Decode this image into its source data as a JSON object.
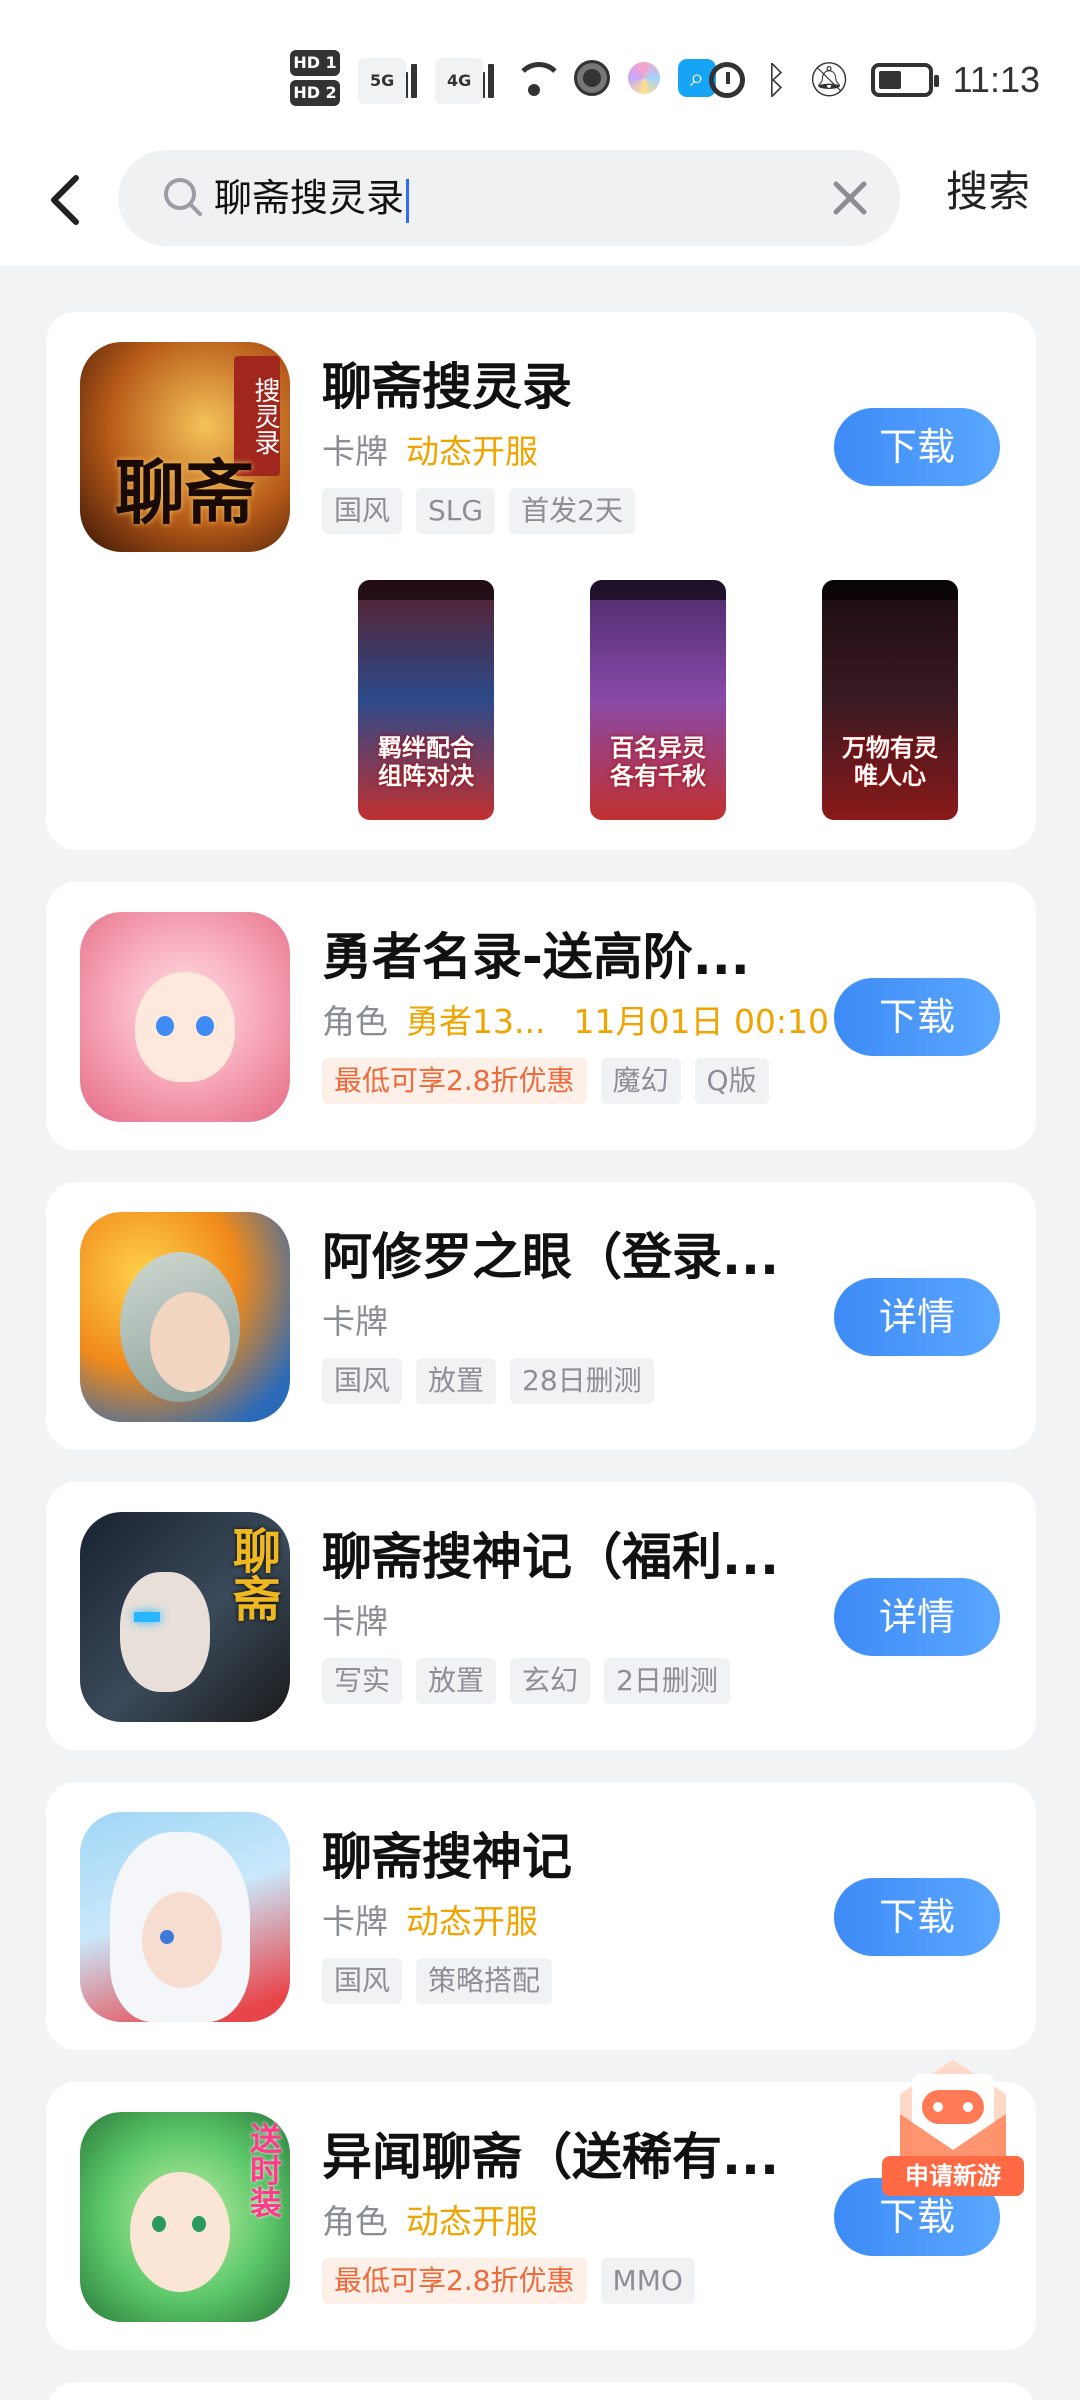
{
  "status_bar": {
    "hd1": "HD 1",
    "hd2": "HD 2",
    "net1": "5G",
    "net2": "4G",
    "time": "11:13"
  },
  "search": {
    "query": "聊斋搜灵录",
    "button_label": "搜索"
  },
  "results": [
    {
      "title": "聊斋搜灵录",
      "category": "卡牌",
      "highlights": [
        "动态开服"
      ],
      "tags": [
        "国风",
        "SLG",
        "首发2天"
      ],
      "button": "下载",
      "icon_glyph": "聊斋",
      "icon_side_text": "搜灵录",
      "screenshots": [
        {
          "caption": "羁绊配合 组阵对决",
          "colors": [
            "#5a1f2a",
            "#2c4a8a",
            "#c03030"
          ]
        },
        {
          "caption": "百名异灵 各有千秋",
          "colors": [
            "#4a2a6a",
            "#8a4aa8",
            "#c03030"
          ]
        },
        {
          "caption": "万物有灵 唯人心",
          "colors": [
            "#1a0c10",
            "#3a1a22",
            "#8a1a1a"
          ]
        }
      ]
    },
    {
      "title": "勇者名录-送高阶...",
      "category": "角色",
      "highlights": [
        "勇者13...",
        "11月01日 00:10"
      ],
      "tags": [
        "最低可享2.8折优惠",
        "魔幻",
        "Q版"
      ],
      "promo_tag_index": 0,
      "button": "下载",
      "icon_glyph": ""
    },
    {
      "title": "阿修罗之眼（登录...",
      "category": "卡牌",
      "highlights": [],
      "tags": [
        "国风",
        "放置",
        "28日删测"
      ],
      "button": "详情",
      "icon_glyph": ""
    },
    {
      "title": "聊斋搜神记（福利...",
      "category": "卡牌",
      "highlights": [],
      "tags": [
        "写实",
        "放置",
        "玄幻",
        "2日删测"
      ],
      "button": "详情",
      "icon_glyph": "聊斋"
    },
    {
      "title": "聊斋搜神记",
      "category": "卡牌",
      "highlights": [
        "动态开服"
      ],
      "tags": [
        "国风",
        "策略搭配"
      ],
      "button": "下载",
      "icon_glyph": ""
    },
    {
      "title": "异闻聊斋（送稀有...",
      "category": "角色",
      "highlights": [
        "动态开服"
      ],
      "tags": [
        "最低可享2.8折优惠",
        "MMO"
      ],
      "promo_tag_index": 0,
      "button": "下载",
      "icon_glyph": "送时装"
    }
  ],
  "floating_badge": {
    "label": "申请新游"
  },
  "colors": {
    "accent": "#3e8bf7",
    "highlight": "#f0a400",
    "promo": "#ee6a3a"
  }
}
